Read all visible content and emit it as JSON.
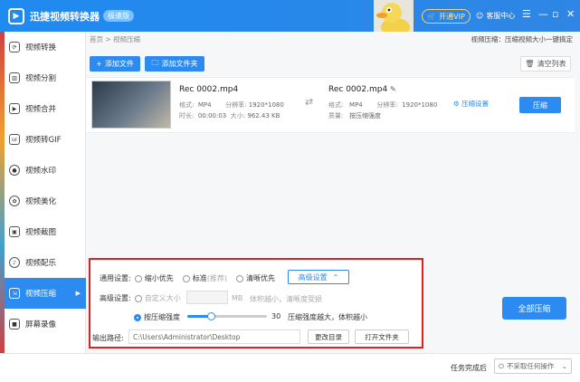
{
  "app": {
    "title": "迅捷视频转换器",
    "badge": "极速版",
    "vip_label": "开通VIP",
    "service_label": "客服中心",
    "menu": "☰",
    "minimize": "—",
    "maximize": "▫",
    "close": "✕"
  },
  "sidebar": {
    "items": [
      {
        "label": "视频转换",
        "icon": "refresh-icon"
      },
      {
        "label": "视频分割",
        "icon": "split-icon"
      },
      {
        "label": "视频合并",
        "icon": "play-icon"
      },
      {
        "label": "视频转GIF",
        "icon": "gif-icon"
      },
      {
        "label": "视频水印",
        "icon": "watermark-icon"
      },
      {
        "label": "视频美化",
        "icon": "beautify-icon"
      },
      {
        "label": "视频截图",
        "icon": "screenshot-icon"
      },
      {
        "label": "视频配乐",
        "icon": "music-icon"
      },
      {
        "label": "视频压缩",
        "icon": "compress-icon",
        "active": true
      },
      {
        "label": "屏幕录像",
        "icon": "record-icon"
      }
    ]
  },
  "breadcrumb": "首页 > 视频压缩",
  "breadcrumb_right": "视频压缩：压缩视频大小一键搞定",
  "toolbar": {
    "add_file": "添加文件",
    "add_folder": "添加文件夹",
    "clear_list": "清空列表"
  },
  "file": {
    "source": {
      "name": "Rec 0002.mp4",
      "format_label": "格式:",
      "format": "MP4",
      "resolution_label": "分辨率:",
      "resolution": "1920*1080",
      "duration_label": "时长:",
      "duration": "00:00:03",
      "size_label": "大小:",
      "size": "962.43 KB"
    },
    "target": {
      "name": "Rec 0002.mp4",
      "format_label": "格式:",
      "format": "MP4",
      "resolution_label": "分辨率:",
      "resolution": "1920*1080",
      "quality_label": "质量:",
      "quality": "按压缩强度"
    },
    "settings_link": "压缩设置",
    "compress_button": "压缩"
  },
  "settings": {
    "general_label": "通用设置:",
    "opt_small": "缩小优先",
    "opt_standard": "标准",
    "opt_standard_note": "(推荐)",
    "opt_clear": "清晰优先",
    "advanced_button": "高级设置",
    "advanced_label": "高级设置:",
    "custom_size": "自定义大小",
    "size_unit": "MB",
    "size_hint": "体积越小，清晰度受损",
    "by_strength": "按压缩强度",
    "strength_value": "30",
    "strength_fraction": 0.3,
    "strength_hint": "压缩强度越大，体积越小",
    "output_label": "输出路径:",
    "output_path": "C:\\Users\\Administrator\\Desktop",
    "change_dir": "更改目录",
    "open_folder": "打开文件夹"
  },
  "compress_all": "全部压缩",
  "footer": {
    "done_label": "任务完成后",
    "done_value": "不采取任何操作"
  }
}
